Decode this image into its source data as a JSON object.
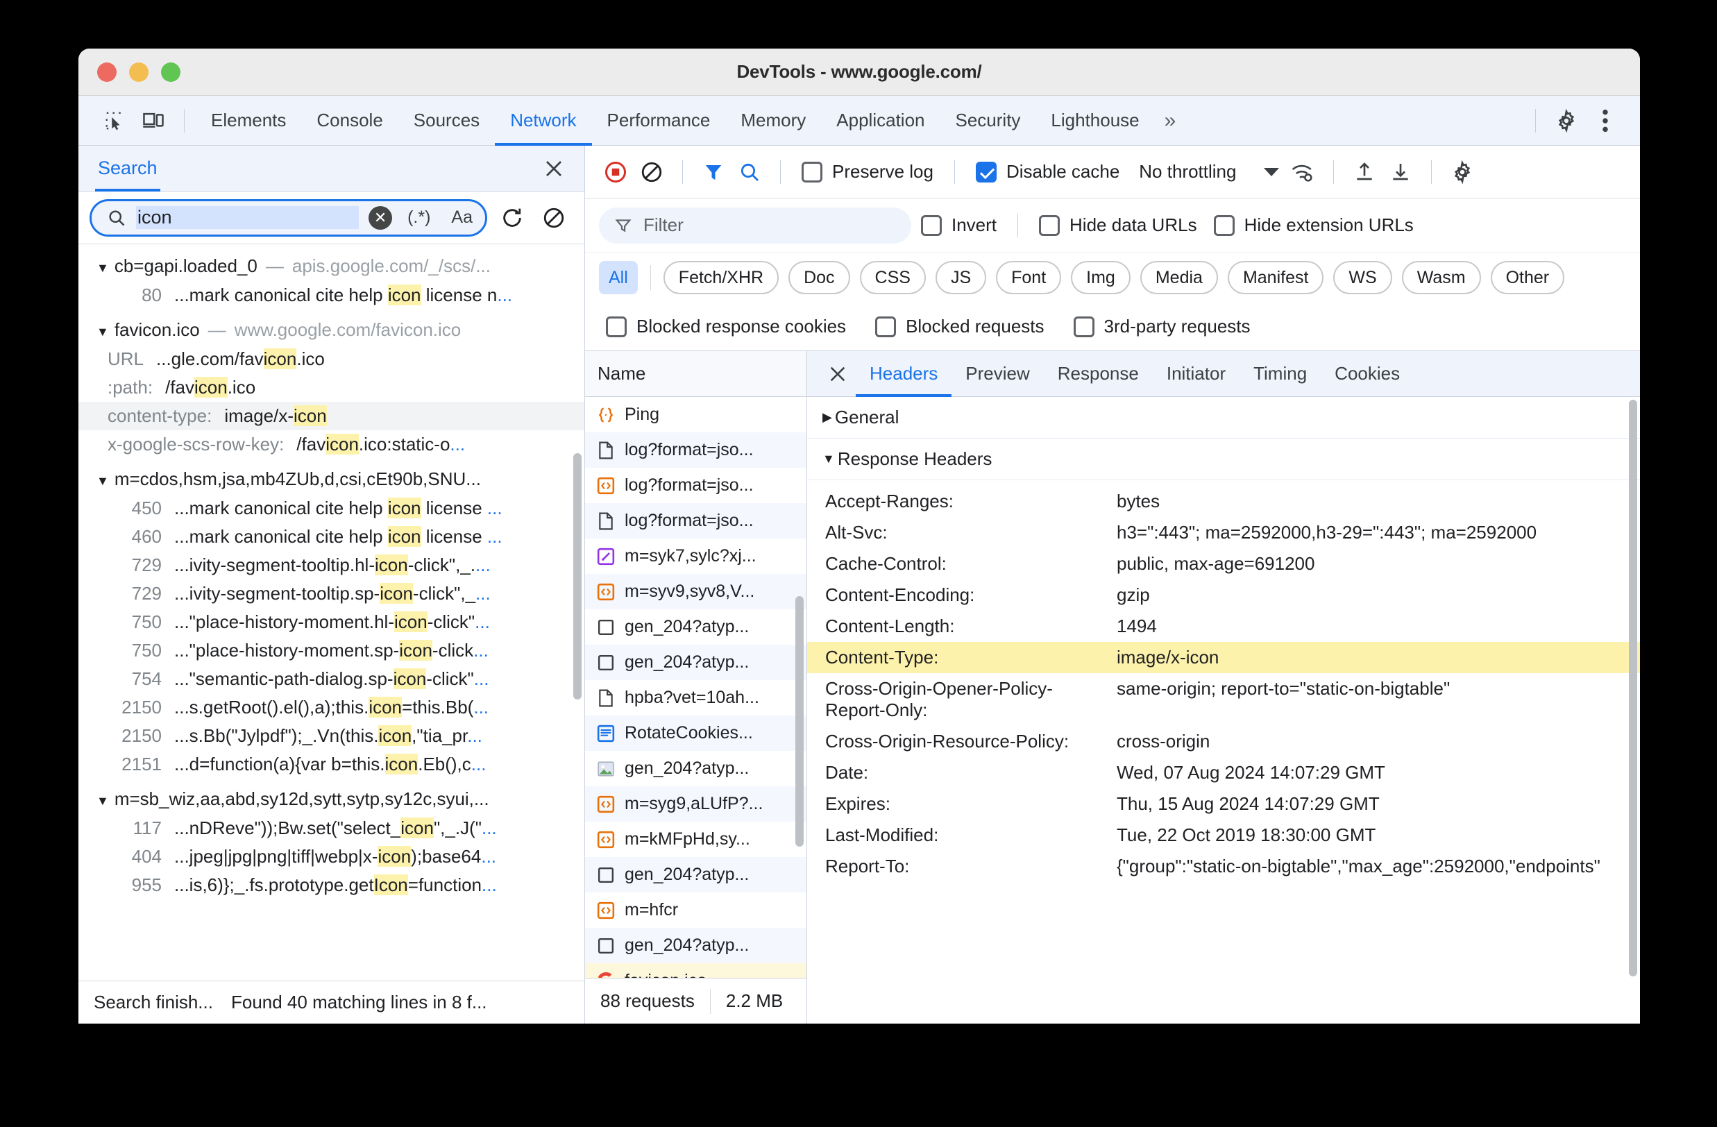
{
  "window": {
    "title": "DevTools - www.google.com/"
  },
  "main_tabs": [
    {
      "label": "Elements",
      "active": false
    },
    {
      "label": "Console",
      "active": false
    },
    {
      "label": "Sources",
      "active": false
    },
    {
      "label": "Network",
      "active": true
    },
    {
      "label": "Performance",
      "active": false
    },
    {
      "label": "Memory",
      "active": false
    },
    {
      "label": "Application",
      "active": false
    },
    {
      "label": "Security",
      "active": false
    },
    {
      "label": "Lighthouse",
      "active": false
    }
  ],
  "main_tabs_overflow": "»",
  "search_panel": {
    "tab_label": "Search",
    "query_value": "icon",
    "regex_label": "(.*)",
    "match_case_label": "Aa",
    "status_left": "Search finish...",
    "status_right": "Found 40 matching lines in 8 f...",
    "groups": [
      {
        "name": "cb=gapi.loaded_0",
        "dash": "—",
        "source": "apis.google.com/_/scs/...",
        "lines": [
          {
            "no": "80",
            "pre": "...mark canonical cite help ",
            "hit": "icon",
            "post": " license n",
            "ell": "..."
          }
        ]
      },
      {
        "name": "favicon.ico",
        "dash": "—",
        "source": "www.google.com/favicon.ico",
        "lines": [
          {
            "key": "URL",
            "pre": "...gle.com/fav",
            "hit": "icon",
            "post": ".ico",
            "ell": ""
          },
          {
            "key": ":path:",
            "pre": "/fav",
            "hit": "icon",
            "post": ".ico",
            "ell": ""
          },
          {
            "key": "content-type:",
            "pre": "image/x-",
            "hit": "icon",
            "post": "",
            "ell": "",
            "selected": true
          },
          {
            "key": "x-google-scs-row-key:",
            "pre": "/fav",
            "hit": "icon",
            "post": ".ico:static-o",
            "ell": "..."
          }
        ]
      },
      {
        "name": "m=cdos,hsm,jsa,mb4ZUb,d,csi,cEt90b,SNU...",
        "dash": "",
        "source": "",
        "lines": [
          {
            "no": "450",
            "pre": "...mark canonical cite help ",
            "hit": "icon",
            "post": " license ",
            "ell": "..."
          },
          {
            "no": "460",
            "pre": "...mark canonical cite help ",
            "hit": "icon",
            "post": " license ",
            "ell": "..."
          },
          {
            "no": "729",
            "pre": "...ivity-segment-tooltip.hl-",
            "hit": "icon",
            "post": "-click\",_.",
            "ell": "..."
          },
          {
            "no": "729",
            "pre": "...ivity-segment-tooltip.sp-",
            "hit": "icon",
            "post": "-click\",_",
            "ell": "..."
          },
          {
            "no": "750",
            "pre": "...\"place-history-moment.hl-",
            "hit": "icon",
            "post": "-click\"",
            "ell": "..."
          },
          {
            "no": "750",
            "pre": "...\"place-history-moment.sp-",
            "hit": "icon",
            "post": "-click",
            "ell": "..."
          },
          {
            "no": "754",
            "pre": "...\"semantic-path-dialog.sp-",
            "hit": "icon",
            "post": "-click\"",
            "ell": "..."
          },
          {
            "no": "2150",
            "pre": "...s.getRoot().el(),a);this.",
            "hit": "icon",
            "post": "=this.Bb(",
            "ell": "..."
          },
          {
            "no": "2150",
            "pre": "...s.Bb(\"Jylpdf\");_.Vn(this.",
            "hit": "icon",
            "post": ",\"tia_pr",
            "ell": "..."
          },
          {
            "no": "2151",
            "pre": "...d=function(a){var b=this.",
            "hit": "icon",
            "post": ".Eb(),c",
            "ell": "..."
          }
        ]
      },
      {
        "name": "m=sb_wiz,aa,abd,sy12d,sytt,sytp,sy12c,syui,...",
        "dash": "",
        "source": "",
        "lines": [
          {
            "no": "117",
            "pre": "...nDReve\"));Bw.set(\"select_",
            "hit": "icon",
            "post": "\",_.J(\"",
            "ell": "..."
          },
          {
            "no": "404",
            "pre": "...jpeg|jpg|png|tiff|webp|x-",
            "hit": "icon",
            "post": ");base64",
            "ell": "..."
          },
          {
            "no": "955",
            "pre": "...is,6)};_.fs.prototype.get",
            "hit": "Icon",
            "post": "=function",
            "ell": "..."
          }
        ]
      }
    ]
  },
  "network": {
    "toolbar": {
      "preserve_log": {
        "label": "Preserve log",
        "checked": false
      },
      "disable_cache": {
        "label": "Disable cache",
        "checked": true
      },
      "throttling": "No throttling"
    },
    "filter_bar": {
      "filter_placeholder": "Filter",
      "invert": {
        "label": "Invert",
        "checked": false
      },
      "hide_data_urls": {
        "label": "Hide data URLs",
        "checked": false
      },
      "hide_extension_urls": {
        "label": "Hide extension URLs",
        "checked": false
      }
    },
    "type_filters": [
      {
        "label": "All",
        "active": true
      },
      {
        "label": "Fetch/XHR",
        "active": false
      },
      {
        "label": "Doc",
        "active": false
      },
      {
        "label": "CSS",
        "active": false
      },
      {
        "label": "JS",
        "active": false
      },
      {
        "label": "Font",
        "active": false
      },
      {
        "label": "Img",
        "active": false
      },
      {
        "label": "Media",
        "active": false
      },
      {
        "label": "Manifest",
        "active": false
      },
      {
        "label": "WS",
        "active": false
      },
      {
        "label": "Wasm",
        "active": false
      },
      {
        "label": "Other",
        "active": false
      }
    ],
    "blocked_row": [
      {
        "label": "Blocked response cookies",
        "checked": false
      },
      {
        "label": "Blocked requests",
        "checked": false
      },
      {
        "label": "3rd-party requests",
        "checked": false
      }
    ],
    "requests": {
      "column_header": "Name",
      "rows": [
        {
          "name": "Ping",
          "icon": "json-icon",
          "selected": false
        },
        {
          "name": "log?format=jso...",
          "icon": "document-icon",
          "selected": false
        },
        {
          "name": "log?format=jso...",
          "icon": "script-icon",
          "selected": false
        },
        {
          "name": "log?format=jso...",
          "icon": "document-icon",
          "selected": false
        },
        {
          "name": "m=syk7,sylc?xj...",
          "icon": "stylesheet-icon",
          "selected": false
        },
        {
          "name": "m=syv9,syv8,V...",
          "icon": "script-icon",
          "selected": false
        },
        {
          "name": "gen_204?atyp...",
          "icon": "generic-icon",
          "selected": false
        },
        {
          "name": "gen_204?atyp...",
          "icon": "generic-icon",
          "selected": false
        },
        {
          "name": "hpba?vet=10ah...",
          "icon": "document-icon",
          "selected": false
        },
        {
          "name": "RotateCookies...",
          "icon": "fetch-icon",
          "selected": false
        },
        {
          "name": "gen_204?atyp...",
          "icon": "image-icon",
          "selected": false
        },
        {
          "name": "m=syg9,aLUfP?...",
          "icon": "script-icon",
          "selected": false
        },
        {
          "name": "m=kMFpHd,sy...",
          "icon": "script-icon",
          "selected": false
        },
        {
          "name": "gen_204?atyp...",
          "icon": "generic-icon",
          "selected": false
        },
        {
          "name": "m=hfcr",
          "icon": "script-icon",
          "selected": false
        },
        {
          "name": "gen_204?atyp...",
          "icon": "generic-icon",
          "selected": false
        },
        {
          "name": "favicon.ico",
          "icon": "google-favicon",
          "selected": true
        }
      ],
      "status": {
        "requests": "88 requests",
        "transferred": "2.2 MB"
      }
    },
    "detail": {
      "tabs": [
        {
          "label": "Headers",
          "active": true
        },
        {
          "label": "Preview",
          "active": false
        },
        {
          "label": "Response",
          "active": false
        },
        {
          "label": "Initiator",
          "active": false
        },
        {
          "label": "Timing",
          "active": false
        },
        {
          "label": "Cookies",
          "active": false
        }
      ],
      "sections": [
        {
          "title": "General",
          "expanded": false
        },
        {
          "title": "Response Headers",
          "expanded": true
        }
      ],
      "response_headers": [
        {
          "key": "Accept-Ranges:",
          "value": "bytes",
          "highlight": false
        },
        {
          "key": "Alt-Svc:",
          "value": "h3=\":443\"; ma=2592000,h3-29=\":443\"; ma=2592000",
          "highlight": false
        },
        {
          "key": "Cache-Control:",
          "value": "public, max-age=691200",
          "highlight": false
        },
        {
          "key": "Content-Encoding:",
          "value": "gzip",
          "highlight": false
        },
        {
          "key": "Content-Length:",
          "value": "1494",
          "highlight": false
        },
        {
          "key": "Content-Type:",
          "value": "image/x-icon",
          "highlight": true
        },
        {
          "key": "Cross-Origin-Opener-Policy-Report-Only:",
          "value": "same-origin; report-to=\"static-on-bigtable\"",
          "highlight": false
        },
        {
          "key": "Cross-Origin-Resource-Policy:",
          "value": "cross-origin",
          "highlight": false
        },
        {
          "key": "Date:",
          "value": "Wed, 07 Aug 2024 14:07:29 GMT",
          "highlight": false
        },
        {
          "key": "Expires:",
          "value": "Thu, 15 Aug 2024 14:07:29 GMT",
          "highlight": false
        },
        {
          "key": "Last-Modified:",
          "value": "Tue, 22 Oct 2019 18:30:00 GMT",
          "highlight": false
        },
        {
          "key": "Report-To:",
          "value": "{\"group\":\"static-on-bigtable\",\"max_age\":2592000,\"endpoints\"",
          "highlight": false
        }
      ]
    }
  },
  "colors": {
    "accent": "#1a73e8",
    "highlight": "#fdf2ab",
    "record": "#d93025"
  }
}
